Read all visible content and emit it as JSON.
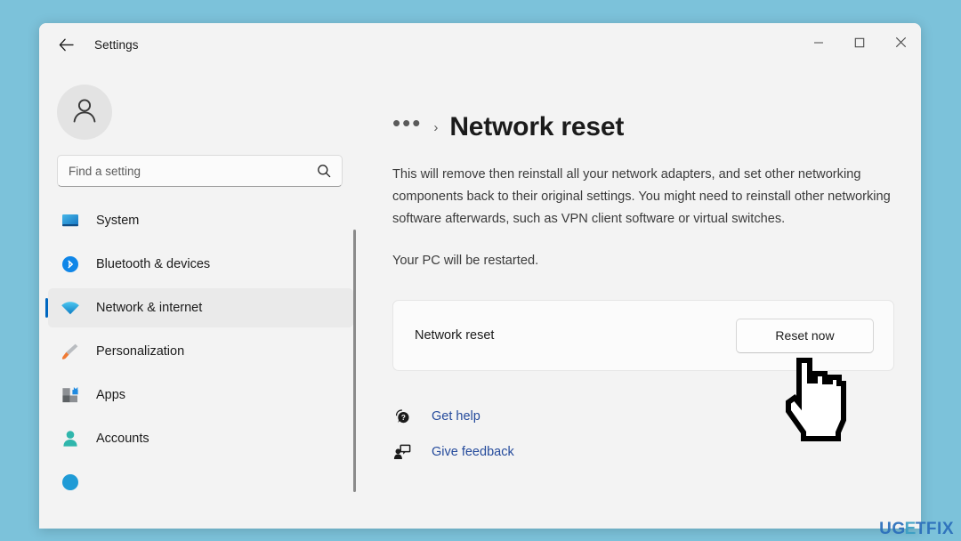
{
  "window": {
    "app_title": "Settings",
    "back_icon": "back-arrow-icon",
    "controls": {
      "minimize": "minimize-icon",
      "maximize": "maximize-icon",
      "close": "close-icon"
    }
  },
  "sidebar": {
    "avatar_icon": "person-avatar-icon",
    "search": {
      "placeholder": "Find a setting",
      "value": "",
      "icon": "search-icon"
    },
    "items": [
      {
        "label": "System",
        "icon": "system-monitor-icon",
        "selected": false
      },
      {
        "label": "Bluetooth & devices",
        "icon": "bluetooth-icon",
        "selected": false
      },
      {
        "label": "Network & internet",
        "icon": "wifi-icon",
        "selected": true
      },
      {
        "label": "Personalization",
        "icon": "paintbrush-icon",
        "selected": false
      },
      {
        "label": "Apps",
        "icon": "apps-blocks-icon",
        "selected": false
      },
      {
        "label": "Accounts",
        "icon": "accounts-person-icon",
        "selected": false
      },
      {
        "label": "",
        "icon": "time-language-icon",
        "selected": false
      }
    ]
  },
  "main": {
    "breadcrumb": {
      "ellipsis": "•••",
      "separator": "›",
      "title": "Network reset"
    },
    "description": "This will remove then reinstall all your network adapters, and set other networking components back to their original settings. You might need to reinstall other networking software afterwards, such as VPN client software or virtual switches.",
    "restart_note": "Your PC will be restarted.",
    "card": {
      "label": "Network reset",
      "button_label": "Reset now"
    },
    "links": [
      {
        "label": "Get help",
        "icon": "help-question-icon"
      },
      {
        "label": "Give feedback",
        "icon": "feedback-person-icon"
      }
    ]
  },
  "watermark": {
    "part_a": "UG",
    "part_mid": "E",
    "part_b": "TFIX"
  },
  "colors": {
    "desktop_background": "#7cc2da",
    "window_background": "#f3f3f3",
    "accent": "#0067c0",
    "link": "#254b9c",
    "selected_row": "#eaeaea"
  },
  "cursor": {
    "type": "pointing-hand-cursor"
  }
}
